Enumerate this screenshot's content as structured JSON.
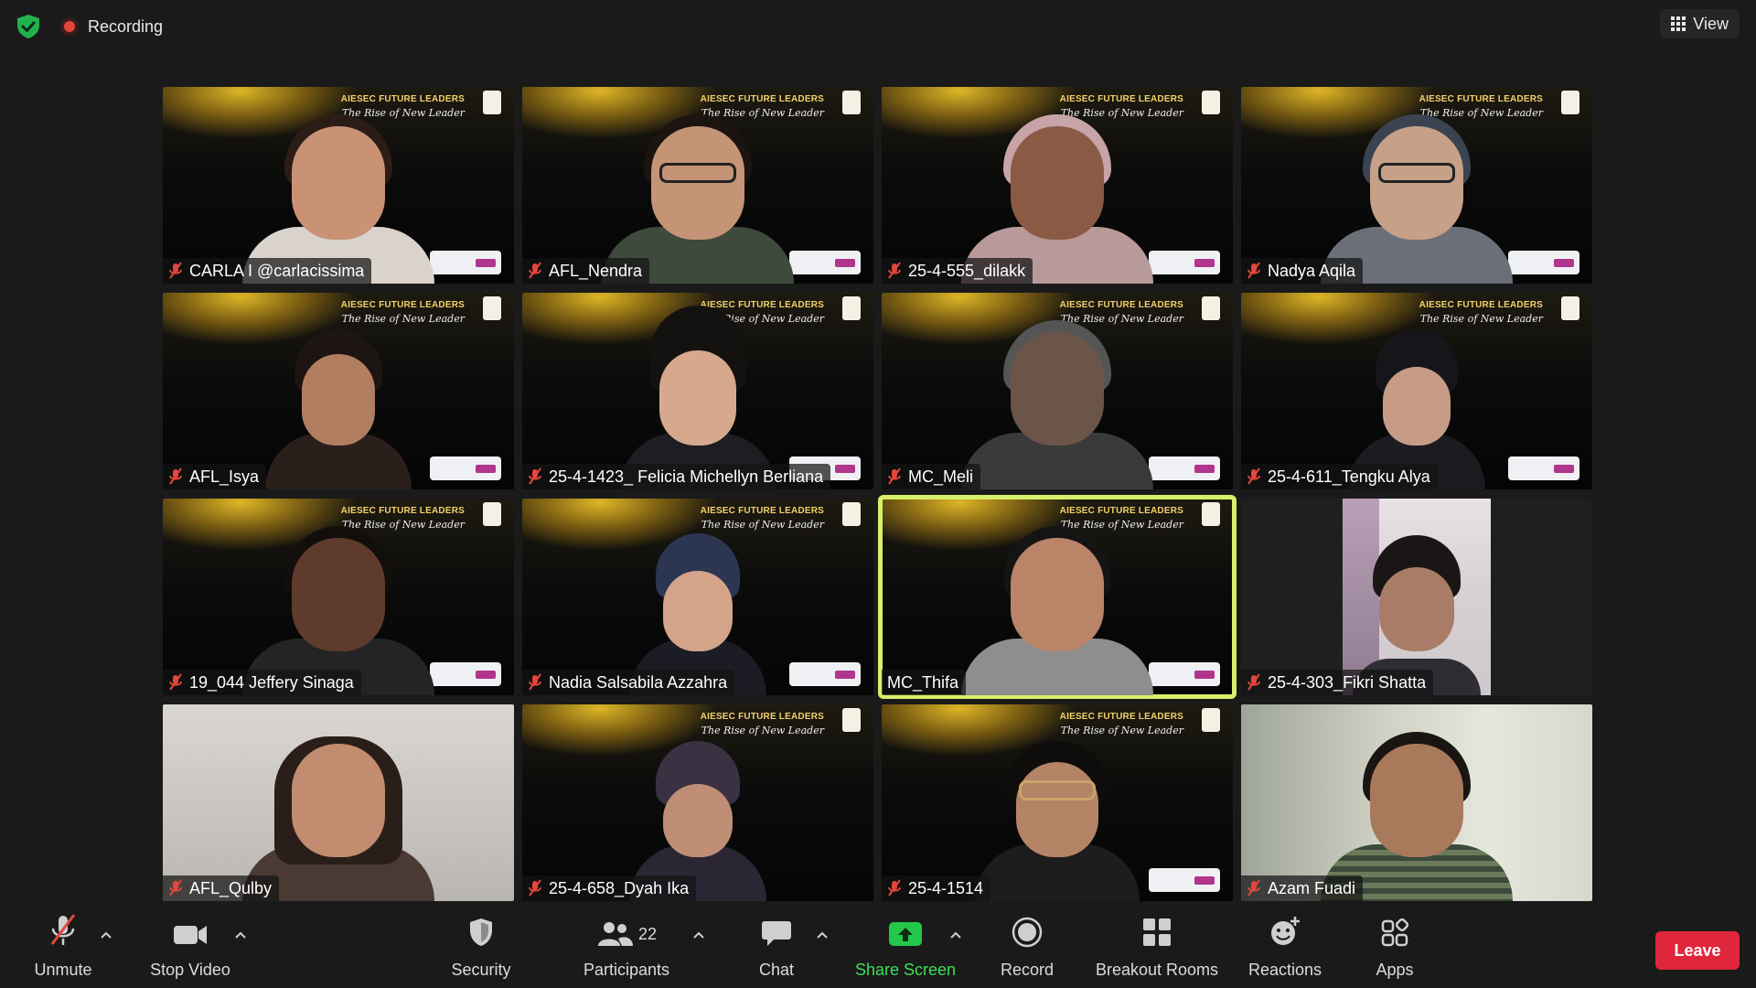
{
  "topbar": {
    "shield_icon": "shield-check-icon",
    "recording_label": "Recording",
    "view_label": "View"
  },
  "tiles": [
    {
      "name": "CARLA I @carlacissima",
      "muted": true
    },
    {
      "name": "AFL_Nendra",
      "muted": true
    },
    {
      "name": "25-4-555_dilakk",
      "muted": true
    },
    {
      "name": "Nadya Aqila",
      "muted": true
    },
    {
      "name": "AFL_Isya",
      "muted": true
    },
    {
      "name": "25-4-1423_ Felicia Michellyn Berliana",
      "muted": true
    },
    {
      "name": "MC_Meli",
      "muted": true
    },
    {
      "name": "25-4-611_Tengku Alya",
      "muted": true
    },
    {
      "name": "19_044 Jeffery Sinaga",
      "muted": true
    },
    {
      "name": "Nadia Salsabila Azzahra",
      "muted": true
    },
    {
      "name": "MC_Thifa",
      "muted": false,
      "speaking": true
    },
    {
      "name": "25-4-303_Fikri Shatta",
      "muted": true
    },
    {
      "name": "AFL_Qulby",
      "muted": true
    },
    {
      "name": "25-4-658_Dyah Ika",
      "muted": true
    },
    {
      "name": "25-4-1514",
      "muted": true
    },
    {
      "name": "Azam Fuadi",
      "muted": true
    }
  ],
  "brand": {
    "title": "AIESEC FUTURE LEADERS",
    "subtitle": "The Rise of New Leader"
  },
  "toolbar": {
    "unmute": "Unmute",
    "stop_video": "Stop Video",
    "security": "Security",
    "participants": "Participants",
    "participants_count": "22",
    "chat": "Chat",
    "share_screen": "Share Screen",
    "record": "Record",
    "breakout_rooms": "Breakout Rooms",
    "reactions": "Reactions",
    "apps": "Apps",
    "leave": "Leave"
  },
  "colors": {
    "background": "#1a1a1a",
    "active_speaker_outline": "#d7f069",
    "share_green": "#3ee05a",
    "leave_red": "#e0263a",
    "mute_red": "#e5463c",
    "brand_gold": "#f2d16b"
  }
}
